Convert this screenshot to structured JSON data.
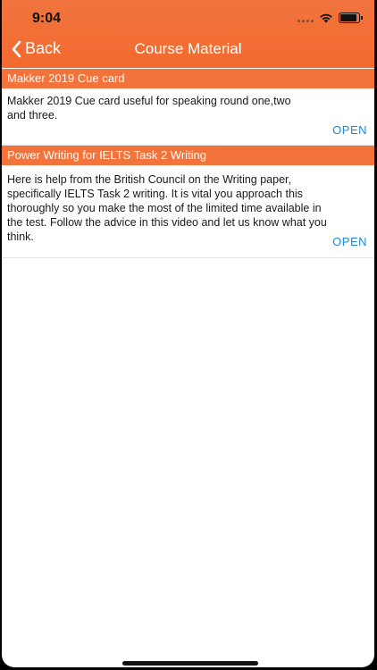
{
  "status": {
    "time": "9:04"
  },
  "nav": {
    "back_label": "Back",
    "title": "Course Material"
  },
  "materials": [
    {
      "title": "Makker 2019 Cue card",
      "description_lines": [
        "Makker 2019 Cue card useful for speaking round one,two",
        "and three."
      ],
      "action_label": "OPEN"
    },
    {
      "title": "Power Writing for IELTS Task 2 Writing",
      "description_lines": [
        "Here is help from the British Council on the Writing paper,",
        "specifically IELTS Task 2 writing. It is vital you approach this",
        "thoroughly so you make the most of the limited time available in",
        "the test. Follow the advice in this video and let us know what you",
        "think."
      ],
      "action_label": "OPEN"
    }
  ],
  "colors": {
    "accent": "#f26a2f",
    "link": "#1e88d9"
  }
}
